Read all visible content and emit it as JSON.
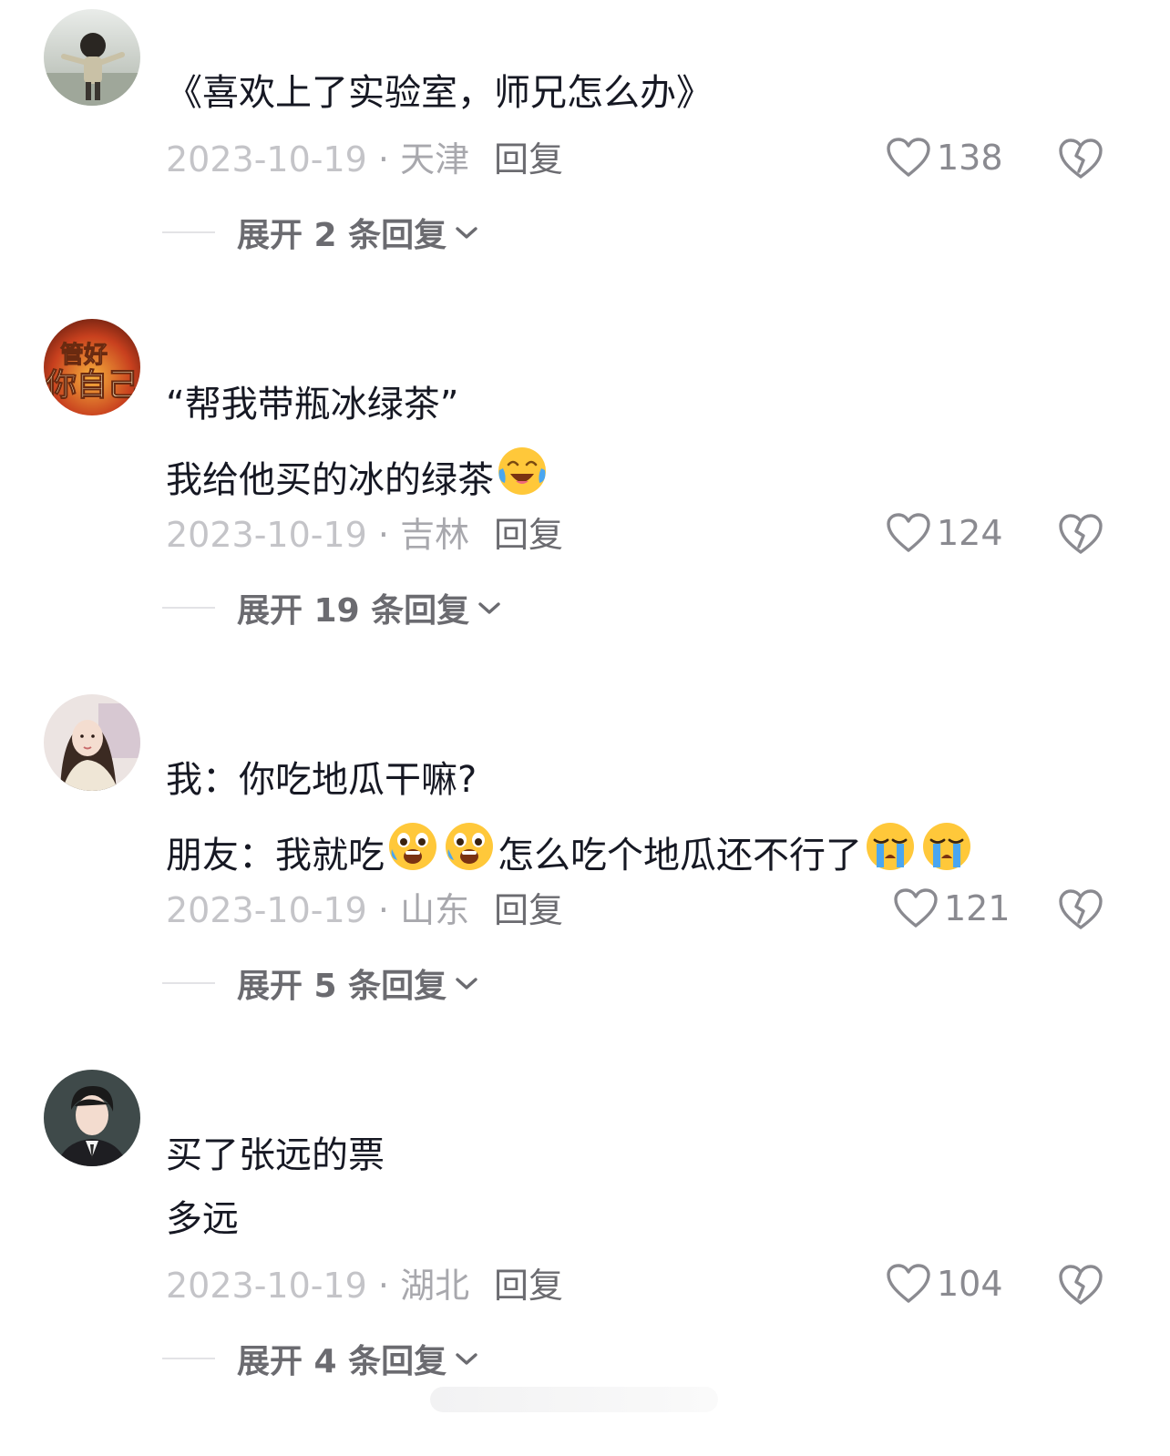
{
  "comments": [
    {
      "username": "",
      "lines": [
        "《喜欢上了实验室，师兄怎么办》"
      ],
      "date": "2023-10-19",
      "location": "天津",
      "reply_label": "回复",
      "likes": "138",
      "expand_label": "展开 2 条回复"
    },
    {
      "username": "",
      "lines": [
        "“帮我带瓶冰绿茶”",
        "我给他买的冰的绿茶"
      ],
      "date": "2023-10-19",
      "location": "吉林",
      "reply_label": "回复",
      "likes": "124",
      "expand_label": "展开 19 条回复",
      "avatar_text": "管好你自己"
    },
    {
      "username": "",
      "lines": [
        "我：你吃地瓜干嘛?",
        "朋友：我就吃",
        "怎么吃个地瓜还不行了"
      ],
      "date": "2023-10-19",
      "location": "山东",
      "reply_label": "回复",
      "likes": "121",
      "expand_label": "展开 5 条回复"
    },
    {
      "username": "",
      "lines": [
        "买了张远的票",
        "多远"
      ],
      "date": "2023-10-19",
      "location": "湖北",
      "reply_label": "回复",
      "likes": "104",
      "expand_label": "展开 4 条回复"
    }
  ],
  "colors": {
    "text": "#161823",
    "meta": "#a8a8ad",
    "action": "#6b6b70"
  },
  "icons": [
    "heart-icon",
    "broken-heart-icon",
    "chevron-down-icon",
    "crying-laughing-emoji",
    "scared-emoji",
    "loudly-crying-emoji"
  ]
}
